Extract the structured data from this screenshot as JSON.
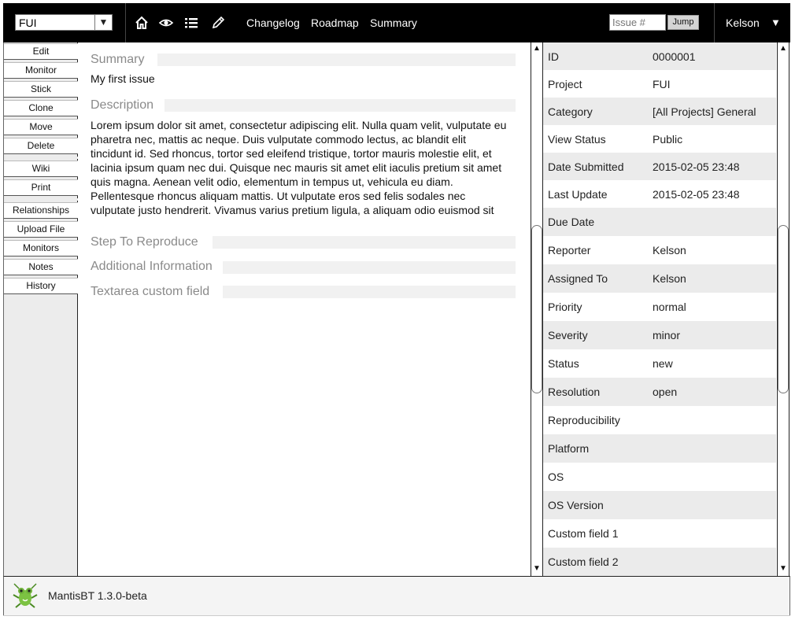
{
  "topbar": {
    "project_selected": "FUI",
    "nav_links": [
      "Changelog",
      "Roadmap",
      "Summary"
    ],
    "issue_placeholder": "Issue #",
    "jump_label": "Jump",
    "user_name": "Kelson",
    "icons": [
      "home-icon",
      "eye-icon",
      "list-icon",
      "pencil-icon"
    ]
  },
  "sidebar": {
    "items": [
      "Edit",
      "Monitor",
      "Stick",
      "Clone",
      "Move",
      "Delete",
      "Wiki",
      "Print",
      "Relationships",
      "Upload File",
      "Monitors",
      "Notes",
      "History"
    ]
  },
  "main": {
    "summary_label": "Summary",
    "summary_text": "My first issue",
    "description_label": "Description",
    "description_lines": [
      "Lorem ipsum dolor sit amet, consectetur adipiscing elit. Nulla quam velit, vulputate eu",
      "pharetra nec, mattis ac neque. Duis vulputate commodo lectus, ac blandit elit",
      "tincidunt id. Sed rhoncus, tortor sed eleifend tristique, tortor mauris molestie elit, et",
      "lacinia ipsum quam nec dui. Quisque nec mauris sit amet elit iaculis pretium sit amet",
      "quis magna. Aenean velit odio, elementum in tempus ut, vehicula eu diam.",
      "Pellentesque rhoncus aliquam mattis. Ut vulputate eros sed felis sodales nec",
      "vulputate justo hendrerit. Vivamus varius pretium ligula, a aliquam odio euismod sit"
    ],
    "steps_label": "Step To Reproduce",
    "additional_label": "Additional Information",
    "textarea_label": "Textarea custom field"
  },
  "properties": [
    {
      "key": "ID",
      "value": "0000001"
    },
    {
      "key": "Project",
      "value": "FUI"
    },
    {
      "key": "Category",
      "value": "[All Projects] General"
    },
    {
      "key": "View Status",
      "value": "Public"
    },
    {
      "key": "Date Submitted",
      "value": "2015-02-05 23:48"
    },
    {
      "key": "Last Update",
      "value": "2015-02-05 23:48"
    },
    {
      "key": "Due Date",
      "value": ""
    },
    {
      "key": "Reporter",
      "value": "Kelson"
    },
    {
      "key": "Assigned To",
      "value": "Kelson"
    },
    {
      "key": "Priority",
      "value": "normal"
    },
    {
      "key": "Severity",
      "value": "minor"
    },
    {
      "key": "Status",
      "value": "new"
    },
    {
      "key": "Resolution",
      "value": "open"
    },
    {
      "key": "Reproducibility",
      "value": ""
    },
    {
      "key": "Platform",
      "value": ""
    },
    {
      "key": "OS",
      "value": ""
    },
    {
      "key": "OS Version",
      "value": ""
    },
    {
      "key": "Custom field 1",
      "value": ""
    },
    {
      "key": "Custom field 2",
      "value": ""
    }
  ],
  "footer": {
    "version_text": "MantisBT 1.3.0-beta",
    "logo_icon": "mantis-logo-icon"
  }
}
